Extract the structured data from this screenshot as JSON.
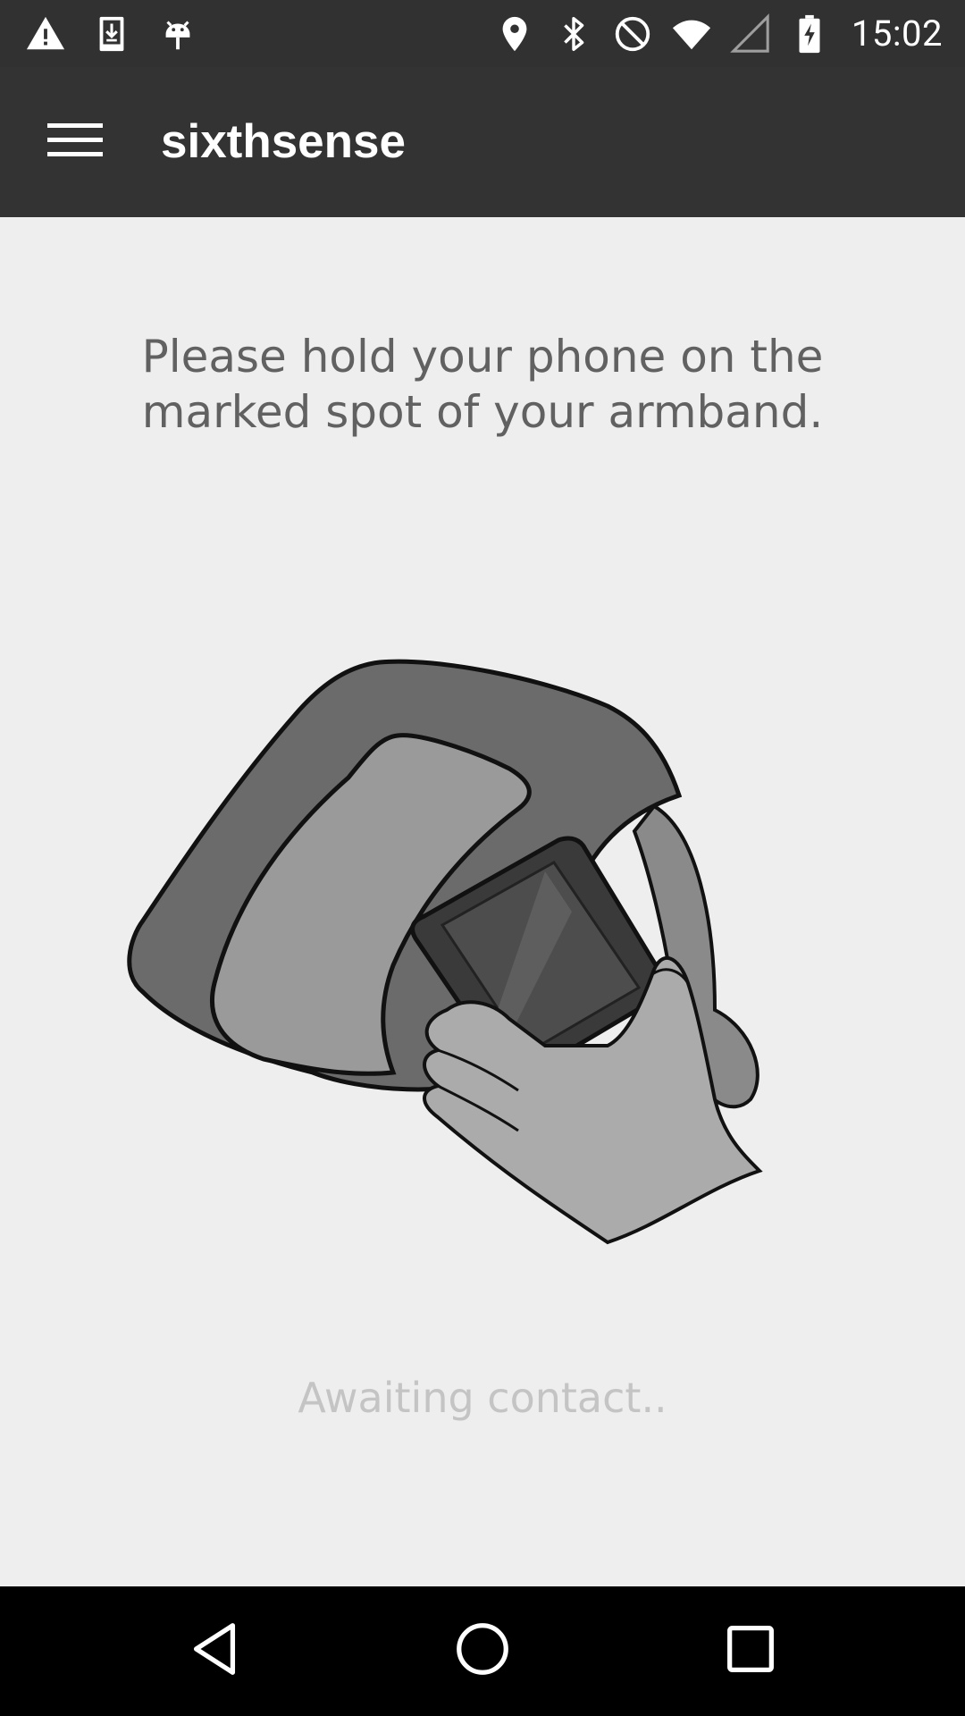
{
  "status_bar": {
    "time": "15:02",
    "left_icons": [
      "warning-icon",
      "download-icon",
      "android-debug-icon"
    ],
    "right_icons": [
      "location-icon",
      "bluetooth-icon",
      "do-not-disturb-icon",
      "wifi-icon",
      "signal-icon",
      "battery-charging-icon"
    ]
  },
  "app_bar": {
    "title": "sixthsense",
    "menu_icon": "hamburger-menu-icon"
  },
  "main": {
    "instruction": "Please hold your phone on the marked spot of your armband.",
    "illustration": "armband-phone-illustration",
    "status_text": "Awaiting contact.."
  },
  "nav_bar": {
    "buttons": [
      "back-icon",
      "home-icon",
      "recents-icon"
    ]
  },
  "colors": {
    "status_bar": "#313131",
    "app_bar": "#333333",
    "background": "#eeeeee",
    "instruction_text": "#616161",
    "status_text": "#c4c4c4"
  }
}
